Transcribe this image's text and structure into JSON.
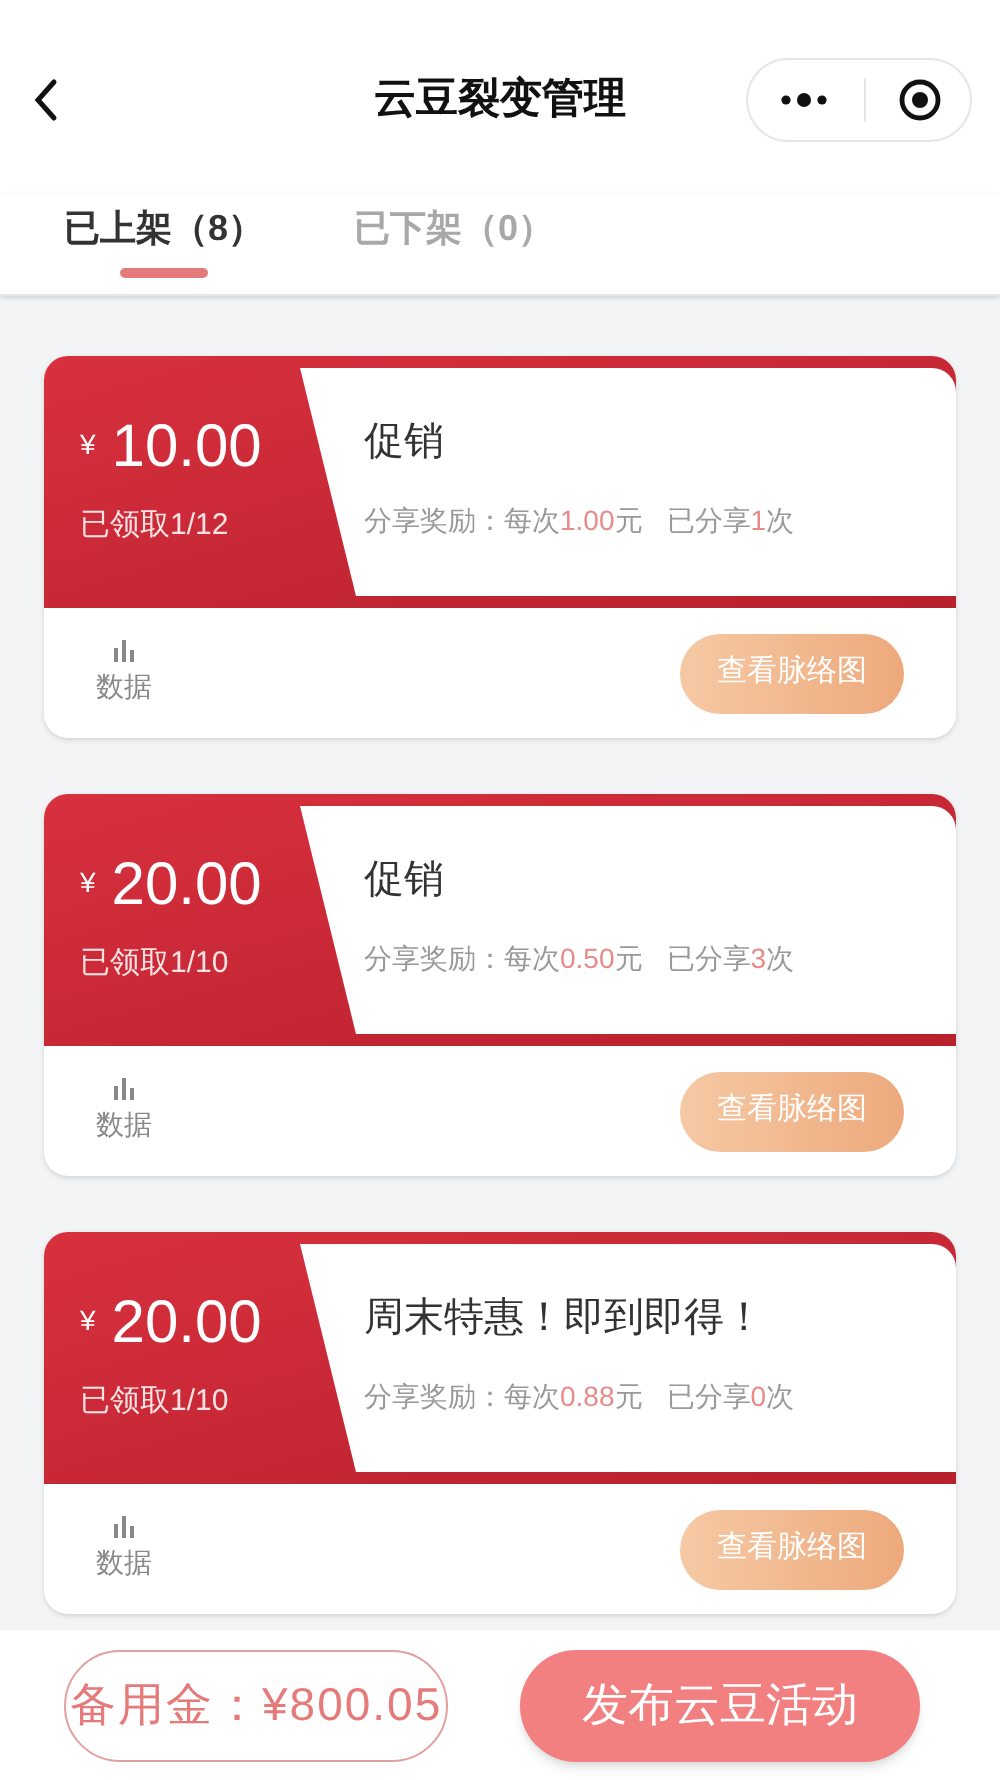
{
  "nav": {
    "title": "云豆裂变管理"
  },
  "tabs": [
    {
      "label": "已上架（8）",
      "selected": true
    },
    {
      "label": "已下架（0）",
      "selected": false
    }
  ],
  "cards": [
    {
      "currency": "¥",
      "amount": "10.00",
      "claimed": "已领取1/12",
      "title": "促销",
      "reward": {
        "label": "分享奖励：每次",
        "value": "1.00",
        "unit": "元"
      },
      "shared": {
        "label": "已分享",
        "value": "1",
        "unit": "次"
      },
      "data_label": "数据",
      "action": "查看脉络图"
    },
    {
      "currency": "¥",
      "amount": "20.00",
      "claimed": "已领取1/10",
      "title": "促销",
      "reward": {
        "label": "分享奖励：每次",
        "value": "0.50",
        "unit": "元"
      },
      "shared": {
        "label": "已分享",
        "value": "3",
        "unit": "次"
      },
      "data_label": "数据",
      "action": "查看脉络图"
    },
    {
      "currency": "¥",
      "amount": "20.00",
      "claimed": "已领取1/10",
      "title": "周末特惠！即到即得！",
      "reward": {
        "label": "分享奖励：每次",
        "value": "0.88",
        "unit": "元"
      },
      "shared": {
        "label": "已分享",
        "value": "0",
        "unit": "次"
      },
      "data_label": "数据",
      "action": "查看脉络图"
    }
  ],
  "bottom_bar": {
    "reserve": "备用金：¥800.05",
    "publish": "发布云豆活动"
  }
}
